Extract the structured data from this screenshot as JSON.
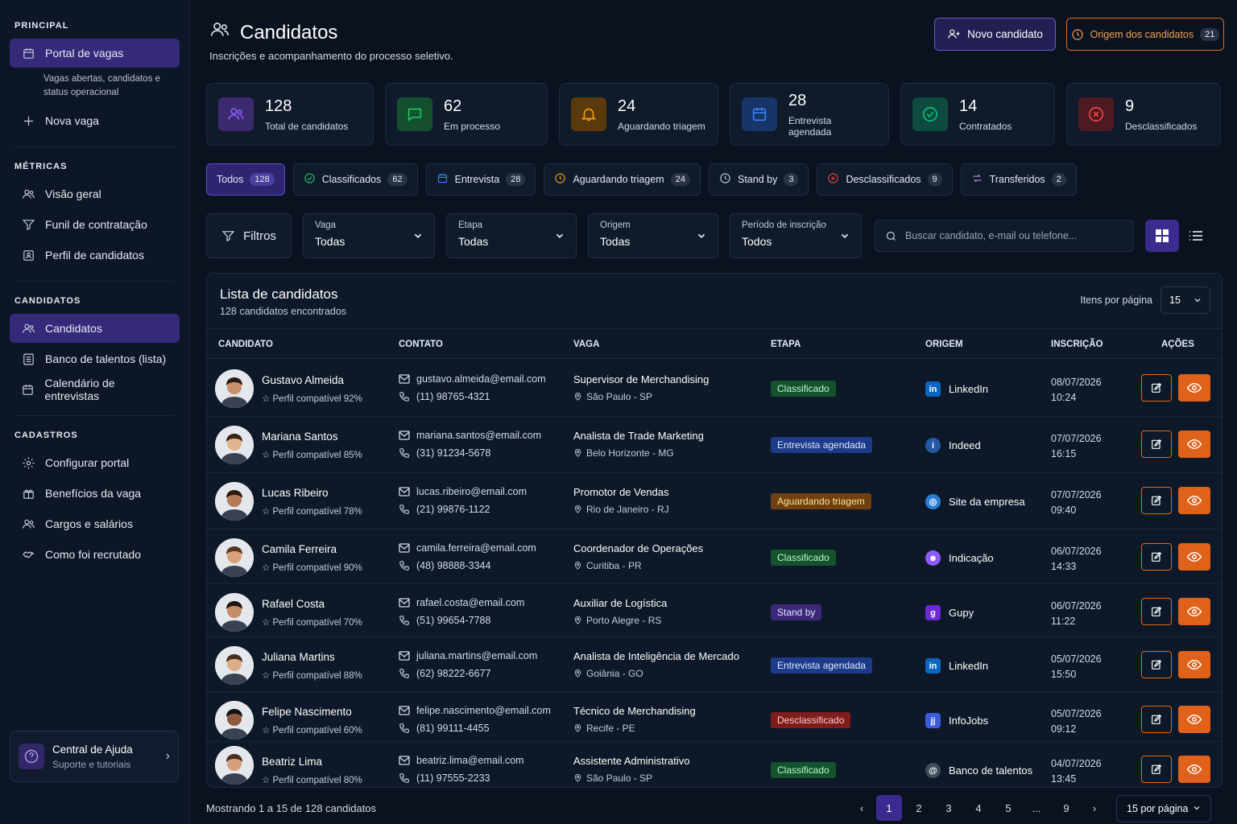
{
  "sidebar": {
    "sections": [
      {
        "title": "PRINCIPAL",
        "items": [
          {
            "label": "Portal de vagas",
            "active": true,
            "icon": "calendar-icon"
          },
          {
            "label": "Nova vaga",
            "icon": "plus-icon"
          }
        ],
        "desc": "Vagas abertas, candidatos e status operacional"
      },
      {
        "title": "MÉTRICAS",
        "items": [
          {
            "label": "Visão geral",
            "icon": "users-icon"
          },
          {
            "label": "Funil de contratação",
            "icon": "filter-icon"
          },
          {
            "label": "Perfil de candidatos",
            "icon": "profile-icon"
          }
        ]
      },
      {
        "title": "CANDIDATOS",
        "items": [
          {
            "label": "Candidatos",
            "active": true,
            "icon": "users-icon"
          },
          {
            "label": "Banco de talentos (lista)",
            "icon": "list-icon"
          },
          {
            "label": "Calendário de entrevistas",
            "icon": "calendar-icon"
          }
        ]
      },
      {
        "title": "CADASTROS",
        "items": [
          {
            "label": "Configurar portal",
            "icon": "gear-icon"
          },
          {
            "label": "Benefícios da vaga",
            "icon": "gift-icon"
          },
          {
            "label": "Cargos e salários",
            "icon": "users-icon"
          },
          {
            "label": "Como foi recrutado",
            "icon": "handshake-icon"
          }
        ]
      }
    ],
    "help": {
      "title": "Central de Ajuda",
      "subtitle": "Suporte e tutoriais"
    }
  },
  "header": {
    "title": "Candidatos",
    "subtitle": "Inscrições e acompanhamento do processo seletivo.",
    "new_button": "Novo candidato",
    "origin_button": "Origem dos candidatos",
    "origin_count": "21"
  },
  "stats": [
    {
      "value": "128",
      "label": "Total de candidatos",
      "color": "#8b5cf6",
      "bg": "#3b2a6e"
    },
    {
      "value": "62",
      "label": "Em processo",
      "color": "#22c55e",
      "bg": "#14502f"
    },
    {
      "value": "24",
      "label": "Aguardando triagem",
      "color": "#f59e0b",
      "bg": "#5a3a0c"
    },
    {
      "value": "28",
      "label": "Entrevista agendada",
      "color": "#3b82f6",
      "bg": "#173566"
    },
    {
      "value": "14",
      "label": "Contratados",
      "color": "#10b981",
      "bg": "#0f4a3f"
    },
    {
      "value": "9",
      "label": "Desclassificados",
      "color": "#ef4444",
      "bg": "#4d1a22"
    }
  ],
  "tabs": [
    {
      "label": "Todos",
      "count": "128",
      "active": true
    },
    {
      "label": "Classificados",
      "count": "62",
      "color": "#22c55e"
    },
    {
      "label": "Entrevista",
      "count": "28",
      "color": "#3b82f6"
    },
    {
      "label": "Aguardando triagem",
      "count": "24",
      "color": "#f59e0b"
    },
    {
      "label": "Stand by",
      "count": "3",
      "color": "#c7cfdd"
    },
    {
      "label": "Desclassificados",
      "count": "9",
      "color": "#ef4444"
    },
    {
      "label": "Transferidos",
      "count": "2",
      "color": "#c084fc"
    }
  ],
  "toolbar": {
    "filters_label": "Filtros",
    "selects": [
      {
        "label": "Vaga",
        "value": "Todas"
      },
      {
        "label": "Etapa",
        "value": "Todas"
      },
      {
        "label": "Origem",
        "value": "Todas"
      },
      {
        "label": "Período de inscrição",
        "value": "Todos"
      }
    ],
    "search_placeholder": "Buscar candidato, e-mail ou telefone..."
  },
  "list": {
    "title": "Lista de candidatos",
    "subtitle": "128 candidatos encontrados",
    "items_per_page_label": "Itens por página",
    "items_per_page": "15",
    "columns": [
      "CANDIDATO",
      "CONTATO",
      "VAGA",
      "ETAPA",
      "ORIGEM",
      "INSCRIÇÃO",
      "AÇÕES"
    ],
    "rows": [
      {
        "name": "Gustavo Almeida",
        "profile": "Perfil compatível 92%",
        "email": "gustavo.almeida@email.com",
        "phone": "(11) 98765-4321",
        "job": "Supervisor de Merchandising",
        "location": "São Paulo - SP",
        "stage": "Classificado",
        "stage_type": "green",
        "origin": "LinkedIn",
        "origin_icon": "in",
        "origin_color": "#0a66c2",
        "date": "08/07/2026",
        "time": "10:24"
      },
      {
        "name": "Mariana Santos",
        "profile": "Perfil compatível 85%",
        "email": "mariana.santos@email.com",
        "phone": "(31) 91234-5678",
        "job": "Analista de Trade Marketing",
        "location": "Belo Horizonte - MG",
        "stage": "Entrevista agendada",
        "stage_type": "blue",
        "origin": "Indeed",
        "origin_icon": "i",
        "origin_color": "#2557a7",
        "date": "07/07/2026",
        "time": "16:15"
      },
      {
        "name": "Lucas Ribeiro",
        "profile": "Perfil compatível 78%",
        "email": "lucas.ribeiro@email.com",
        "phone": "(21) 99876-1122",
        "job": "Promotor de Vendas",
        "location": "Rio de Janeiro - RJ",
        "stage": "Aguardando triagem",
        "stage_type": "amber",
        "origin": "Site da empresa",
        "origin_icon": "◎",
        "origin_color": "#2a7fd4",
        "date": "07/07/2026",
        "time": "09:40"
      },
      {
        "name": "Camila Ferreira",
        "profile": "Perfil compatível 90%",
        "email": "camila.ferreira@email.com",
        "phone": "(48) 98888-3344",
        "job": "Coordenador de Operações",
        "location": "Curitiba - PR",
        "stage": "Classificado",
        "stage_type": "green",
        "origin": "Indicação",
        "origin_icon": "☻",
        "origin_color": "#8b5cf6",
        "date": "06/07/2026",
        "time": "14:33"
      },
      {
        "name": "Rafael Costa",
        "profile": "Perfil compatível 70%",
        "email": "rafael.costa@email.com",
        "phone": "(51) 99654-7788",
        "job": "Auxiliar de Logística",
        "location": "Porto Alegre - RS",
        "stage": "Stand by",
        "stage_type": "purple",
        "origin": "Gupy",
        "origin_icon": "g",
        "origin_color": "#6d28d9",
        "date": "06/07/2026",
        "time": "11:22"
      },
      {
        "name": "Juliana Martins",
        "profile": "Perfil compatível 88%",
        "email": "juliana.martins@email.com",
        "phone": "(62) 98222-6677",
        "job": "Analista de Inteligência de Mercado",
        "location": "Goiânia - GO",
        "stage": "Entrevista agendada",
        "stage_type": "blue",
        "origin": "LinkedIn",
        "origin_icon": "in",
        "origin_color": "#0a66c2",
        "date": "05/07/2026",
        "time": "15:50"
      },
      {
        "name": "Felipe Nascimento",
        "profile": "Perfil compatível 60%",
        "email": "felipe.nascimento@email.com",
        "phone": "(81) 99111-4455",
        "job": "Técnico de Merchandising",
        "location": "Recife - PE",
        "stage": "Desclassificado",
        "stage_type": "red",
        "origin": "InfoJobs",
        "origin_icon": "jj",
        "origin_color": "#3b5bdb",
        "date": "05/07/2026",
        "time": "09:12"
      },
      {
        "name": "Beatriz Lima",
        "profile": "Perfil compatível 80%",
        "email": "beatriz.lima@email.com",
        "phone": "(11) 97555-2233",
        "job": "Assistente Administrativo",
        "location": "São Paulo - SP",
        "stage": "Classificado",
        "stage_type": "green",
        "origin": "Banco de talentos",
        "origin_icon": "@",
        "origin_color": "#3f4a5c",
        "date": "04/07/2026",
        "time": "13:45"
      }
    ]
  },
  "footer": {
    "showing": "Mostrando 1 a 15 de 128 candidatos",
    "pages": [
      "1",
      "2",
      "3",
      "4",
      "5",
      "...",
      "9"
    ],
    "current_page": "1",
    "per_page": "15 por página"
  }
}
